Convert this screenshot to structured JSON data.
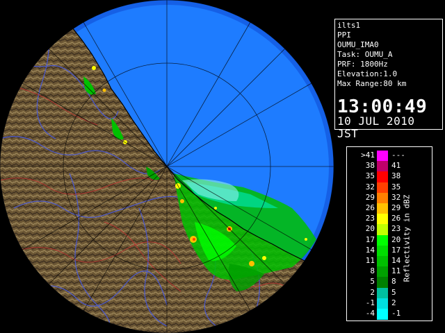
{
  "info": {
    "lines": [
      "ilts1",
      "PPI",
      "OUMU_IMA0",
      "Task: OUMU_A",
      "PRF: 1800Hz",
      "Elevation:1.0",
      "Max Range:80 km"
    ],
    "time": "13:00:49",
    "date": "10 JUL 2010 JST"
  },
  "legend": {
    "unit": "Reflectivity in dBZ",
    "bins": [
      {
        "low": ">41",
        "high": "---",
        "color": "#ff00ff"
      },
      {
        "low": "38",
        "high": "41",
        "color": "#c0006a"
      },
      {
        "low": "35",
        "high": "38",
        "color": "#ff0000"
      },
      {
        "low": "32",
        "high": "35",
        "color": "#ff4000"
      },
      {
        "low": "29",
        "high": "32",
        "color": "#ff8000"
      },
      {
        "low": "26",
        "high": "29",
        "color": "#ffc000"
      },
      {
        "low": "23",
        "high": "26",
        "color": "#ffff00"
      },
      {
        "low": "20",
        "high": "23",
        "color": "#c0ff00"
      },
      {
        "low": "17",
        "high": "20",
        "color": "#00ff00"
      },
      {
        "low": "14",
        "high": "17",
        "color": "#00dd00"
      },
      {
        "low": "11",
        "high": "14",
        "color": "#00c000"
      },
      {
        "low": "8",
        "high": "11",
        "color": "#00a000"
      },
      {
        "low": "5",
        "high": "8",
        "color": "#008000"
      },
      {
        "low": "2",
        "high": "5",
        "color": "#00c0a0"
      },
      {
        "low": "-1",
        "high": "2",
        "color": "#00e0e0"
      },
      {
        "low": "-4",
        "high": "-1",
        "color": "#00ffff"
      }
    ]
  },
  "map": {
    "sea_color": "#1e7cff",
    "outer_color": "#1560e6",
    "land_color": "#6e5a38"
  }
}
